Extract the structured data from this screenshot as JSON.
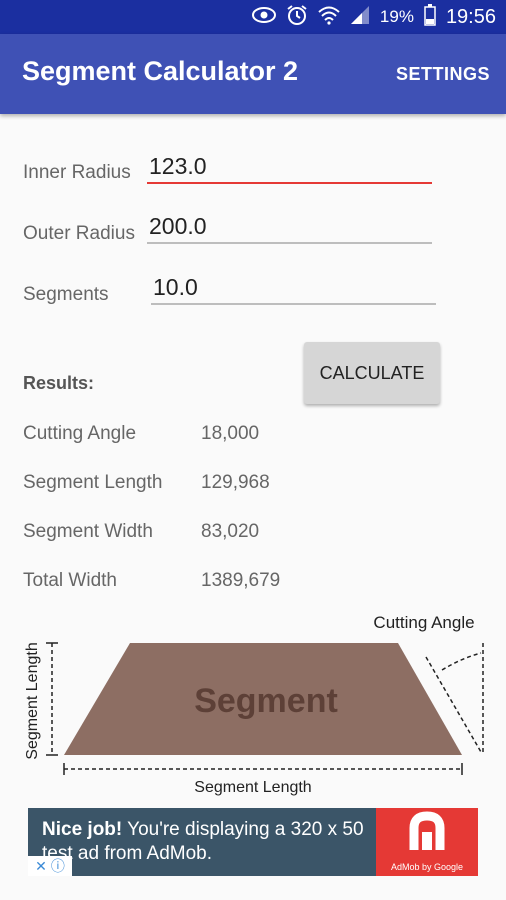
{
  "status": {
    "battery": "19%",
    "time": "19:56"
  },
  "appbar": {
    "title": "Segment Calculator 2",
    "settings_label": "SETTINGS"
  },
  "form": {
    "inner_radius": {
      "label": "Inner Radius",
      "value": "123.0"
    },
    "outer_radius": {
      "label": "Outer Radius",
      "value": "200.0"
    },
    "segments": {
      "label": "Segments",
      "value": "10.0"
    },
    "calculate_label": "CALCULATE"
  },
  "results": {
    "title": "Results:",
    "rows": [
      {
        "label": "Cutting Angle",
        "value": "18,000"
      },
      {
        "label": "Segment Length",
        "value": "129,968"
      },
      {
        "label": "Segment Width",
        "value": "83,020"
      },
      {
        "label": "Total Width",
        "value": "1389,679"
      }
    ]
  },
  "diagram": {
    "segment_label": "Segment",
    "cutting_angle_label": "Cutting Angle",
    "bottom_label": "Segment Length",
    "side_label": "Segment Length",
    "segment_color": "#8d6e63"
  },
  "ad": {
    "headline": "Nice job!",
    "body": " You're displaying a 320 x 50 test ad from AdMob.",
    "brand": "AdMob by Google"
  },
  "icons": [
    "eye-icon",
    "alarm-icon",
    "wifi-icon",
    "signal-icon",
    "battery-icon",
    "close-icon",
    "info-icon"
  ]
}
